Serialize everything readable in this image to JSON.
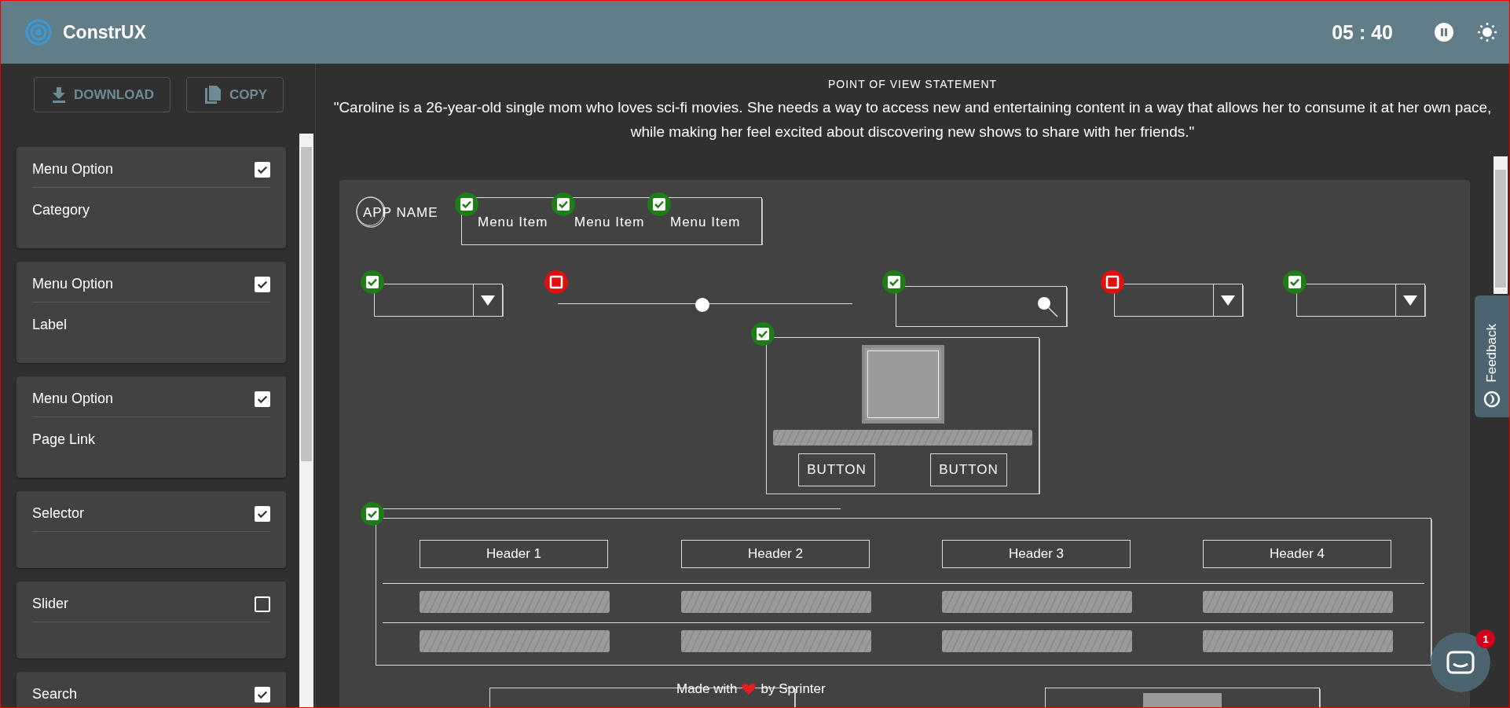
{
  "header": {
    "app_name": "ConstrUX",
    "timer": "05 : 40"
  },
  "sidebar": {
    "buttons": [
      {
        "kind": "download",
        "label": "DOWNLOAD"
      },
      {
        "kind": "copy",
        "label": "COPY"
      }
    ],
    "items": [
      {
        "title": "Menu Option",
        "subtitle": "Category",
        "checked": true
      },
      {
        "title": "Menu Option",
        "subtitle": "Label",
        "checked": true
      },
      {
        "title": "Menu Option",
        "subtitle": "Page Link",
        "checked": true
      },
      {
        "title": "Selector",
        "checked": true
      },
      {
        "title": "Slider",
        "checked": false
      },
      {
        "title": "Search",
        "checked": true
      }
    ]
  },
  "statement": {
    "title": "POINT OF VIEW STATEMENT",
    "text": "\"Caroline is a 26-year-old single mom who loves sci-fi movies. She needs a way to access new and entertaining content in a way that allows her to consume it at her own pace, while making her feel excited about discovering new shows to share with her friends.\""
  },
  "wireframe": {
    "app_name": "APP NAME",
    "menu_items": [
      {
        "label": "Menu Item",
        "checked": true
      },
      {
        "label": "Menu Item",
        "checked": true
      },
      {
        "label": "Menu Item",
        "checked": true
      }
    ],
    "controls": [
      {
        "kind": "dropdown",
        "checked": true
      },
      {
        "kind": "slider",
        "checked": false
      },
      {
        "kind": "search",
        "checked": true
      },
      {
        "kind": "dropdown",
        "checked": false
      },
      {
        "kind": "dropdown",
        "checked": true
      }
    ],
    "card": {
      "checked": true,
      "buttons": [
        "BUTTON",
        "BUTTON"
      ]
    },
    "table": {
      "checked": true,
      "headers": [
        "Header 1",
        "Header 2",
        "Header 3",
        "Header 4"
      ]
    }
  },
  "footer": {
    "before": "Made with",
    "after": "by Sprinter"
  },
  "feedback_tab": {
    "label": "Feedback"
  },
  "chat": {
    "badge": "1"
  }
}
